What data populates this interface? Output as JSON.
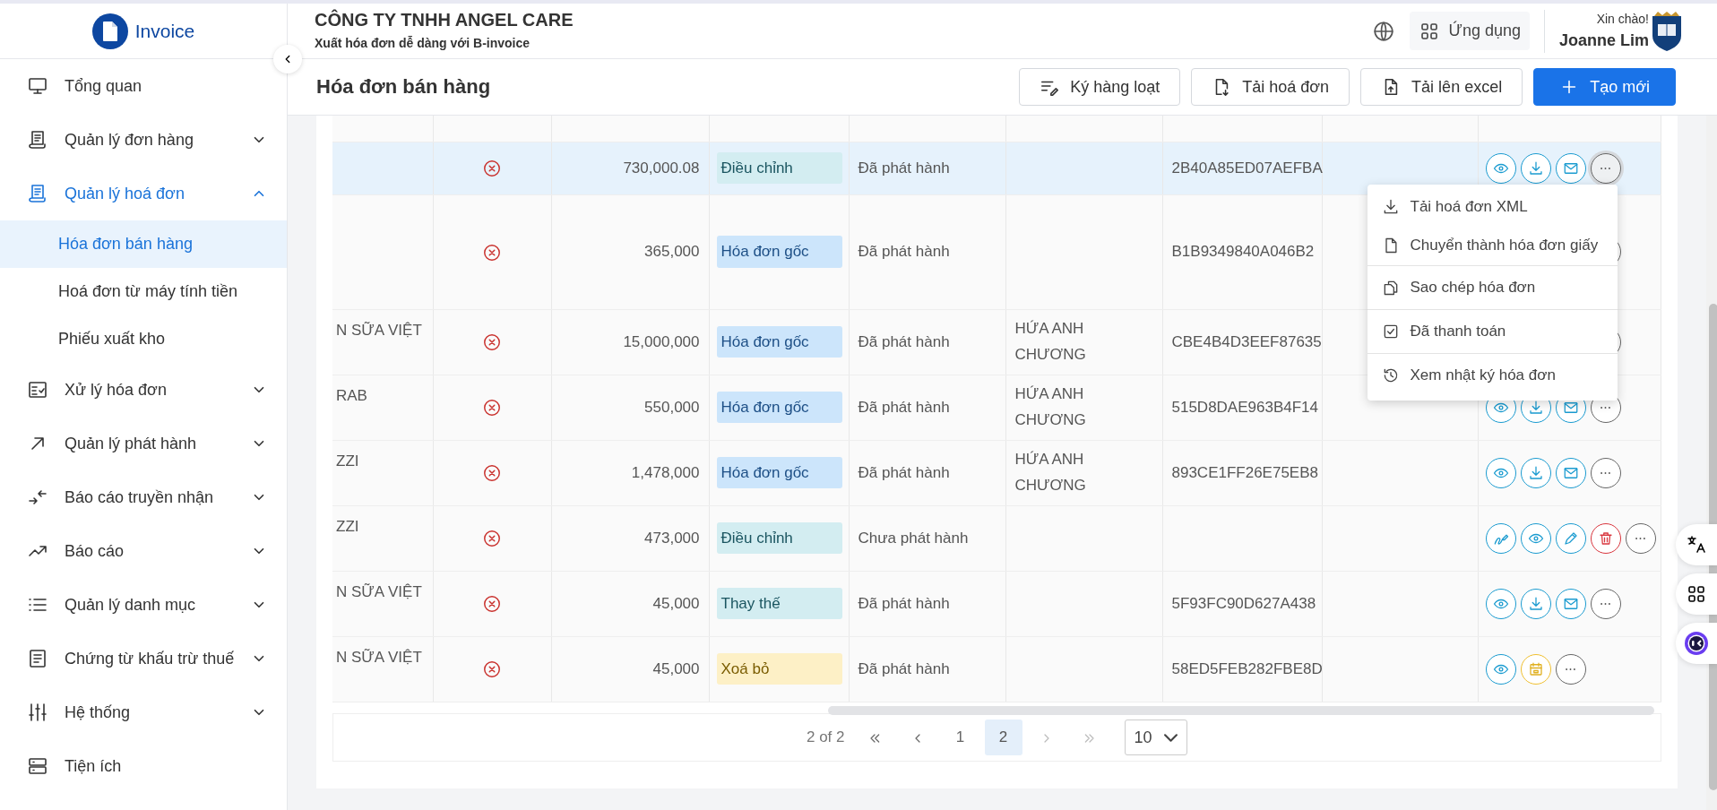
{
  "brand": {
    "name": "Invoice"
  },
  "sidebar": {
    "items": [
      {
        "label": "Tổng quan",
        "kind": "monitor",
        "expandable": false,
        "selected": false
      },
      {
        "label": "Quản lý đơn hàng",
        "kind": "receipt",
        "expandable": true,
        "expanded": false,
        "selected": false
      },
      {
        "label": "Quản lý hoá đơn",
        "kind": "receipt",
        "expandable": true,
        "expanded": true,
        "selected": true,
        "children": [
          {
            "label": "Hóa đơn bán hàng",
            "selected": true
          },
          {
            "label": "Hoá đơn từ máy tính tiền",
            "selected": false
          },
          {
            "label": "Phiếu xuất kho",
            "selected": false
          }
        ]
      },
      {
        "label": "Xử lý hóa đơn",
        "kind": "checklist",
        "expandable": true,
        "expanded": false,
        "selected": false
      },
      {
        "label": "Quản lý phát hành",
        "kind": "arrow",
        "expandable": true,
        "expanded": false,
        "selected": false
      },
      {
        "label": "Báo cáo truyền nhận",
        "kind": "arrows",
        "expandable": true,
        "expanded": false,
        "selected": false
      },
      {
        "label": "Báo cáo",
        "kind": "trend",
        "expandable": true,
        "expanded": false,
        "selected": false
      },
      {
        "label": "Quản lý danh mục",
        "kind": "list",
        "expandable": true,
        "expanded": false,
        "selected": false
      },
      {
        "label": "Chứng từ khấu trừ thuế",
        "kind": "document",
        "expandable": true,
        "expanded": false,
        "selected": false
      },
      {
        "label": "Hệ thống",
        "kind": "sliders",
        "expandable": true,
        "expanded": false,
        "selected": false
      },
      {
        "label": "Tiện ích",
        "kind": "storage",
        "expandable": false,
        "selected": false
      }
    ]
  },
  "header": {
    "company": "CÔNG TY TNHH ANGEL CARE",
    "tagline": "Xuất hóa đơn dễ dàng với B-invoice",
    "apps_label": "Ứng dụng",
    "greeting": "Xin chào!",
    "user": "Joanne Lim"
  },
  "page": {
    "title": "Hóa đơn bán hàng",
    "actions": [
      {
        "label": "Ký hàng loạt",
        "kind": "sign-list",
        "primary": false
      },
      {
        "label": "Tải hoá đơn",
        "kind": "file-download",
        "primary": false
      },
      {
        "label": "Tải lên excel",
        "kind": "file-upload",
        "primary": false
      },
      {
        "label": "Tạo mới",
        "kind": "plus",
        "primary": true
      }
    ]
  },
  "table": {
    "rows": [
      {
        "selected": true,
        "menu_open": true,
        "amount": "730,000.08",
        "type": {
          "label": "Điều chỉnh",
          "kind": "adjust"
        },
        "status": "Đã phát hành",
        "code": "2B40A85ED07AEFBA",
        "actions": [
          {
            "kind": "view"
          },
          {
            "kind": "download"
          },
          {
            "kind": "mail"
          },
          {
            "kind": "more"
          }
        ]
      },
      {
        "selected": false,
        "menu_open": false,
        "amount": "365,000",
        "type": {
          "label": "Hóa đơn gốc",
          "kind": "original"
        },
        "status": "Đã phát hành",
        "code": "B1B9349840A046B2",
        "actions": [
          {
            "kind": "more"
          }
        ]
      },
      {
        "selected": false,
        "menu_open": false,
        "name": "N SỮA VIỆT",
        "amount": "15,000,000",
        "type": {
          "label": "Hóa đơn gốc",
          "kind": "original"
        },
        "status": "Đã phát hành",
        "person": "HỨA ANH CHƯƠNG",
        "code": "CBE4B4D3EEF87635",
        "actions": [
          {
            "kind": "more"
          }
        ]
      },
      {
        "selected": false,
        "menu_open": false,
        "name": "RAB",
        "amount": "550,000",
        "type": {
          "label": "Hóa đơn gốc",
          "kind": "original"
        },
        "status": "Đã phát hành",
        "person": "HỨA ANH CHƯƠNG",
        "code": "515D8DAE963B4F14",
        "actions": [
          {
            "kind": "view"
          },
          {
            "kind": "download"
          },
          {
            "kind": "mail"
          },
          {
            "kind": "more"
          }
        ]
      },
      {
        "selected": false,
        "menu_open": false,
        "name": "ZZI",
        "amount": "1,478,000",
        "type": {
          "label": "Hóa đơn gốc",
          "kind": "original"
        },
        "status": "Đã phát hành",
        "person": "HỨA ANH CHƯƠNG",
        "code": "893CE1FF26E75EB8",
        "actions": [
          {
            "kind": "view"
          },
          {
            "kind": "download"
          },
          {
            "kind": "mail"
          },
          {
            "kind": "more"
          }
        ]
      },
      {
        "selected": false,
        "menu_open": false,
        "name": "ZZI",
        "amount": "473,000",
        "type": {
          "label": "Điều chỉnh",
          "kind": "adjust"
        },
        "status": "Chưa phát hành",
        "actions": [
          {
            "kind": "sign"
          },
          {
            "kind": "view"
          },
          {
            "kind": "edit"
          },
          {
            "kind": "delete"
          },
          {
            "kind": "more"
          }
        ]
      },
      {
        "selected": false,
        "menu_open": false,
        "name": "N SỮA VIỆT",
        "amount": "45,000",
        "type": {
          "label": "Thay thế",
          "kind": "replace"
        },
        "status": "Đã phát hành",
        "code": "5F93FC90D627A438",
        "actions": [
          {
            "kind": "view"
          },
          {
            "kind": "download"
          },
          {
            "kind": "mail"
          },
          {
            "kind": "more"
          }
        ]
      },
      {
        "selected": false,
        "menu_open": false,
        "name": "N SỮA VIỆT",
        "amount": "45,000",
        "type": {
          "label": "Xoá bỏ",
          "kind": "delete"
        },
        "status": "Đã phát hành",
        "code": "58ED5FEB282FBE8D",
        "actions": [
          {
            "kind": "view"
          },
          {
            "kind": "calendar"
          },
          {
            "kind": "more"
          }
        ]
      }
    ]
  },
  "row_menu": {
    "items": [
      {
        "label": "Tải hoá đơn XML",
        "kind": "download",
        "separator_above": false
      },
      {
        "label": "Chuyển thành hóa đơn giấy",
        "kind": "file",
        "separator_above": false
      },
      {
        "label": "Sao chép hóa đơn",
        "kind": "copy",
        "separator_above": true
      },
      {
        "label": "Đã thanh toán",
        "kind": "checkbox",
        "separator_above": true
      },
      {
        "label": "Xem nhật ký hóa đơn",
        "kind": "history",
        "separator_above": true
      }
    ]
  },
  "pagination": {
    "summary": "2 of 2",
    "pages": [
      {
        "label": "1",
        "selected": false
      },
      {
        "label": "2",
        "selected": true
      }
    ],
    "next_disabled": true,
    "page_size": "10"
  }
}
